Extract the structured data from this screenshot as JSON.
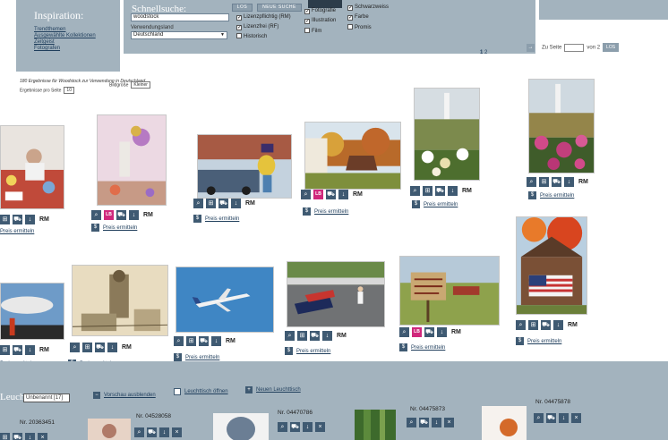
{
  "header": {
    "inspiration": {
      "title": "Inspiration:",
      "links": [
        "Trendthemen",
        "Ausgewählte Kollektionen",
        "Zeitgeist",
        "Fotografen"
      ]
    },
    "quick_search": {
      "title": "Schnellsuche:",
      "input_value": "woodstock",
      "go_label": "LOS",
      "new_search_label": "NEUE SUCHE",
      "country_label": "Verwendungsland",
      "country_value": "Deutschland",
      "checkboxes": [
        {
          "label": "Lizenzpflichtig (RM)",
          "checked": true
        },
        {
          "label": "Lizenzfrei (RF)",
          "checked": true
        },
        {
          "label": "Historisch",
          "checked": false
        },
        {
          "label": "Fotografie",
          "checked": true
        },
        {
          "label": "Illustration",
          "checked": true
        },
        {
          "label": "Film",
          "checked": false
        },
        {
          "label": "Schwarzweiss",
          "checked": true
        },
        {
          "label": "Farbe",
          "checked": true
        },
        {
          "label": "Promis",
          "checked": false
        }
      ]
    }
  },
  "results": {
    "summary": "180 Ergebnisse für Woodstock zur Verwendung in Deutschland",
    "per_page_label": "Ergebnisse pro Seite",
    "per_page_value": "10",
    "size_label": "Bildgröße",
    "size_value": "Kleiner"
  },
  "pager": {
    "pages": [
      "1",
      "2"
    ],
    "goto_label": "Zu Seite",
    "of_label": "von 2",
    "go_label": "LOS"
  },
  "grid": {
    "license_label": "RM",
    "price_label": "Preis ermitteln",
    "badge_label": "LB"
  },
  "lightbox": {
    "title": "Leuchtisch",
    "select_value": "Unbenannt [17]",
    "hide_preview": "Vorschau ausblenden",
    "open": "Leuchttisch öffnen",
    "new": "Neuen Leuchttisch",
    "numbers": [
      "Nr. 20363451",
      "Nr. 04528058",
      "Nr. 04470786",
      "Nr. 04475873",
      "Nr. 04475878"
    ]
  },
  "colors": {
    "panel": "#a3b3be",
    "link": "#1f3e5c",
    "icon": "#3f5a72",
    "badge": "#d0287c"
  },
  "icons": [
    "zoom-icon",
    "lightbox-icon",
    "cart-icon",
    "download-icon",
    "price-icon"
  ]
}
